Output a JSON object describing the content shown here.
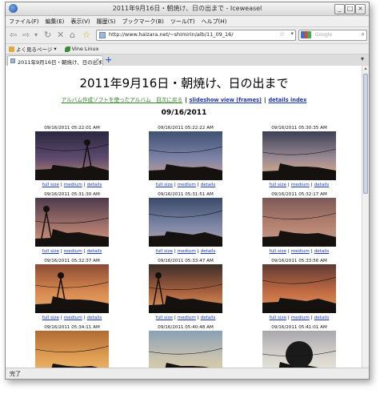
{
  "window": {
    "title": "2011年9月16日・朝焼け、日の出まで - Iceweasel",
    "buttons": {
      "minimize": "_",
      "maximize": "□",
      "close": "×"
    }
  },
  "menu": [
    "ファイル(F)",
    "編集(E)",
    "表示(V)",
    "履歴(S)",
    "ブックマーク(B)",
    "ツール(T)",
    "ヘルプ(H)"
  ],
  "nav": {
    "back": "⇦",
    "forward": "⇨",
    "history_dropdown": "▾",
    "reload": "↻",
    "stop": "✕",
    "home": "⌂",
    "bookmark": "☆",
    "url": "http://www.haizara.net/~shimirin/alb/11_09_16/",
    "search_placeholder": "Google"
  },
  "bookmarks": [
    {
      "label": "よく見るページ",
      "arrow": "▾"
    },
    {
      "label": "Vine Linux"
    }
  ],
  "tab": {
    "label": "2011年9月16日・朝焼け、日の出まで",
    "close": "×",
    "new": "+",
    "menu": "▾"
  },
  "page": {
    "title": "2011年9月16日・朝焼け、日の出まで",
    "nav_links": {
      "album_link": "アルバム作成ソフトを使ったアルバム　目次に戻る",
      "sep": "|",
      "slideshow": "slideshow view (frames)",
      "details_index": "details index"
    },
    "date": "09/16/2011",
    "link_labels": {
      "full": "full size",
      "medium": "medium",
      "details": "details",
      "sep": "|"
    },
    "photos": [
      {
        "time": "09/16/2011 05:22:01 AM",
        "palette": [
          "#2a2740",
          "#5d4a6e",
          "#c28a75"
        ]
      },
      {
        "time": "09/16/2011 05:22:22 AM",
        "palette": [
          "#3f5172",
          "#7c83a8",
          "#cfa18c"
        ]
      },
      {
        "time": "09/16/2011 05:30:35 AM",
        "palette": [
          "#3c3f55",
          "#9a8a95",
          "#e7b37d"
        ]
      },
      {
        "time": "09/16/2011 05:31:30 AM",
        "palette": [
          "#4d3b4c",
          "#9f6f6a",
          "#d99b78"
        ]
      },
      {
        "time": "09/16/2011 05:31:51 AM",
        "palette": [
          "#3b4a6b",
          "#7c84a4",
          "#b3a5b0"
        ]
      },
      {
        "time": "09/16/2011 05:32:17 AM",
        "palette": [
          "#7b5a58",
          "#b68270",
          "#c79f8f"
        ]
      },
      {
        "time": "09/16/2011 05:32:37 AM",
        "palette": [
          "#8b4c34",
          "#d7874e",
          "#e9ae72"
        ]
      },
      {
        "time": "09/16/2011 05:33:47 AM",
        "palette": [
          "#3c2e2a",
          "#a65f3d",
          "#e3a05e"
        ]
      },
      {
        "time": "09/16/2011 05:33:56 AM",
        "palette": [
          "#5e3a33",
          "#c06a43",
          "#e59a5d"
        ]
      },
      {
        "time": "09/16/2011 05:34:11 AM",
        "palette": [
          "#b06a33",
          "#e0a054",
          "#f2c27c"
        ]
      },
      {
        "time": "09/16/2011 05:40:48 AM",
        "palette": [
          "#8aa0b4",
          "#c8c2b0",
          "#e6d2a6"
        ]
      },
      {
        "time": "09/16/2011 05:41:01 AM",
        "palette": [
          "#a8a7ad",
          "#d9d6cf",
          "#f0ece0"
        ]
      }
    ]
  },
  "status": "完了"
}
